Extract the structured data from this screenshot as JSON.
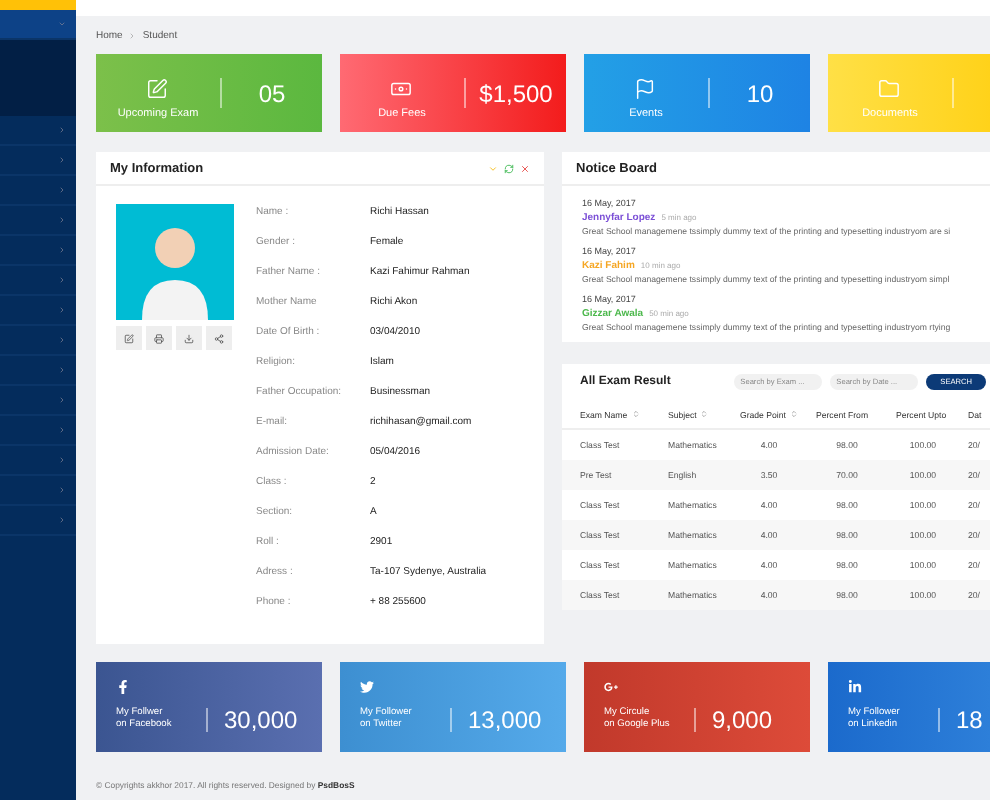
{
  "sidebar": {
    "items": [
      {
        "expanded": true
      },
      {
        "expanded": false
      },
      {
        "expanded": false
      },
      {
        "expanded": false
      },
      {
        "expanded": false
      },
      {
        "expanded": false
      },
      {
        "expanded": false
      },
      {
        "expanded": false
      },
      {
        "expanded": false
      },
      {
        "expanded": false
      },
      {
        "expanded": false
      },
      {
        "expanded": false
      },
      {
        "expanded": false
      },
      {
        "expanded": false
      },
      {
        "expanded": false
      }
    ]
  },
  "breadcrumb": [
    "Home",
    "Student"
  ],
  "stat_cards": [
    {
      "kind": "exam",
      "label": "Upcoming Exam",
      "value": "05"
    },
    {
      "kind": "fees",
      "label": "Due Fees",
      "value": "$1,500"
    },
    {
      "kind": "events",
      "label": "Events",
      "value": "10"
    },
    {
      "kind": "documents",
      "label": "Documents"
    }
  ],
  "my_information": {
    "title": "My Information",
    "fields": [
      {
        "label": "Name :",
        "value": "Richi Hassan"
      },
      {
        "label": "Gender :",
        "value": "Female"
      },
      {
        "label": "Father Name :",
        "value": "Kazi Fahimur Rahman"
      },
      {
        "label": "Mother Name",
        "value": "Richi Akon"
      },
      {
        "label": "Date Of Birth :",
        "value": "03/04/2010"
      },
      {
        "label": "Religion:",
        "value": "Islam"
      },
      {
        "label": "Father Occupation:",
        "value": "Businessman"
      },
      {
        "label": "E-mail:",
        "value": "richihasan@gmail.com"
      },
      {
        "label": "Admission Date:",
        "value": "05/04/2016"
      },
      {
        "label": "Class :",
        "value": "2"
      },
      {
        "label": "Section:",
        "value": "A"
      },
      {
        "label": "Roll :",
        "value": "2901"
      },
      {
        "label": "Adress :",
        "value": "Ta-107 Sydenye, Australia"
      },
      {
        "label": "Phone :",
        "value": "+ 88 255600"
      }
    ]
  },
  "notice_board": {
    "title": "Notice Board",
    "notices": [
      {
        "date": "16 May, 2017",
        "author": "Jennyfar Lopez",
        "color": "#7b4fd6",
        "time": "5 min ago",
        "text": "Great School managemene tssimply dummy text of the printing and typesetting industryom are si"
      },
      {
        "date": "16 May, 2017",
        "author": "Kazi Fahim",
        "color": "#f5a623",
        "time": "10 min ago",
        "text": "Great School managemene tssimply dummy text of the printing and typesetting industryom simpl"
      },
      {
        "date": "16 May, 2017",
        "author": "Gizzar Awala",
        "color": "#4cb84c",
        "time": "50 min ago",
        "text": "Great School managemene tssimply dummy text of the printing and typesetting industryom rtying"
      }
    ]
  },
  "exam_results": {
    "title": "All Exam Result",
    "search_exam": {
      "placeholder": "Search by Exam ..."
    },
    "search_date": {
      "placeholder": "Search by Date ..."
    },
    "search_button": "SEARCH",
    "columns": [
      {
        "label": "Exam Name",
        "sortable": true
      },
      {
        "label": "Subject",
        "sortable": true
      },
      {
        "label": "Grade Point",
        "sortable": true
      },
      {
        "label": "Percent From",
        "sortable": false
      },
      {
        "label": "Percent Upto",
        "sortable": false
      },
      {
        "label": "Dat",
        "sortable": false
      }
    ],
    "rows": [
      [
        "Class Test",
        "Mathematics",
        "4.00",
        "98.00",
        "100.00",
        "20/"
      ],
      [
        "Pre Test",
        "English",
        "3.50",
        "70.00",
        "100.00",
        "20/"
      ],
      [
        "Class Test",
        "Mathematics",
        "4.00",
        "98.00",
        "100.00",
        "20/"
      ],
      [
        "Class Test",
        "Mathematics",
        "4.00",
        "98.00",
        "100.00",
        "20/"
      ],
      [
        "Class Test",
        "Mathematics",
        "4.00",
        "98.00",
        "100.00",
        "20/"
      ],
      [
        "Class Test",
        "Mathematics",
        "4.00",
        "98.00",
        "100.00",
        "20/"
      ]
    ]
  },
  "social_cards": [
    {
      "kind": "facebook",
      "label_lines": [
        "My Follwer",
        "on Facebook"
      ],
      "value": "30,000"
    },
    {
      "kind": "twitter",
      "label_lines": [
        "My Follower",
        "on Twitter"
      ],
      "value": "13,000"
    },
    {
      "kind": "googleplus",
      "label_lines": [
        "My Circule",
        "on Google Plus"
      ],
      "value": "9,000"
    },
    {
      "kind": "linkedin",
      "label_lines": [
        "My Follower",
        "on Linkedin"
      ],
      "value": "18"
    }
  ],
  "footer": {
    "text": "© Copyrights akkhor 2017. All rights reserved. Designed by",
    "link": "PsdBosS"
  }
}
